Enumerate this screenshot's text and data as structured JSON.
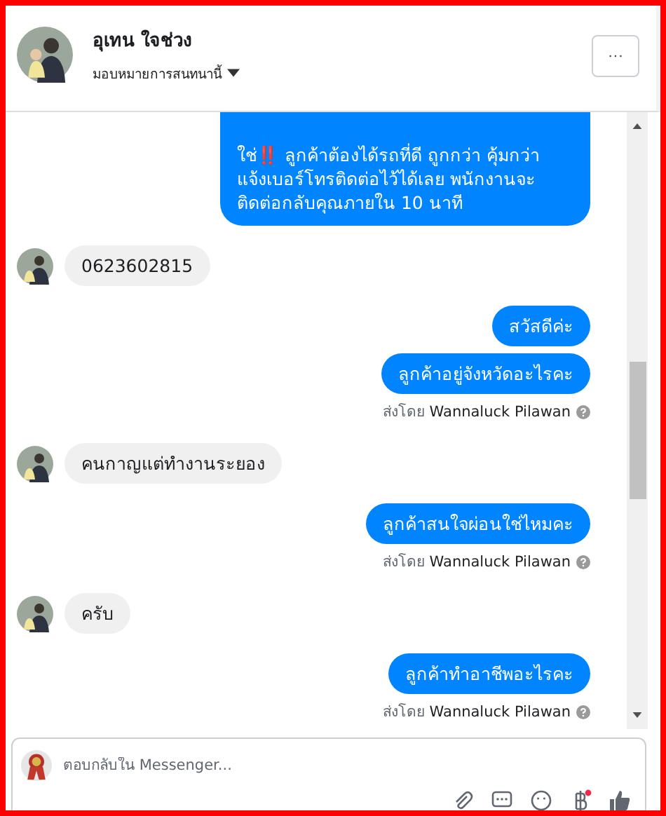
{
  "header": {
    "name": "อุเทน ใจช่วง",
    "assign": "มอบหมายการสนทนานี้",
    "more_button": "···"
  },
  "messages": [
    {
      "kind": "outgoing",
      "text": "ใช่‼️ ลูกค้าต้องได้รถที่ดี ถูกกว่า คุ้มกว่า แจ้งเบอร์โทรติดต่อไว้ได้เลย พนักงานจะติดต่อกลับคุณภายใน 10 นาที",
      "cut_top": true
    },
    {
      "kind": "incoming",
      "text": "0623602815"
    },
    {
      "kind": "outgoing",
      "text": "สวัสดีค่ะ"
    },
    {
      "kind": "outgoing",
      "text": "ลูกค้าอยู่จังหวัดอะไรคะ"
    },
    {
      "kind": "sender",
      "text": "ส่งโดย **Wannaluck Pilawan**"
    },
    {
      "kind": "incoming",
      "text": "คนกาญแต่ทำงานระยอง"
    },
    {
      "kind": "outgoing",
      "text": "ลูกค้าสนใจผ่อนใช่ไหมคะ"
    },
    {
      "kind": "sender",
      "text": "ส่งโดย **Wannaluck Pilawan**"
    },
    {
      "kind": "incoming",
      "text": "ครับ"
    },
    {
      "kind": "outgoing",
      "text": "ลูกค้าทำอาชีพอะไรคะ"
    },
    {
      "kind": "sender",
      "text": "ส่งโดย **Wannaluck Pilawan**"
    }
  ],
  "composer": {
    "placeholder": "ตอบกลับใน Messenger..."
  }
}
